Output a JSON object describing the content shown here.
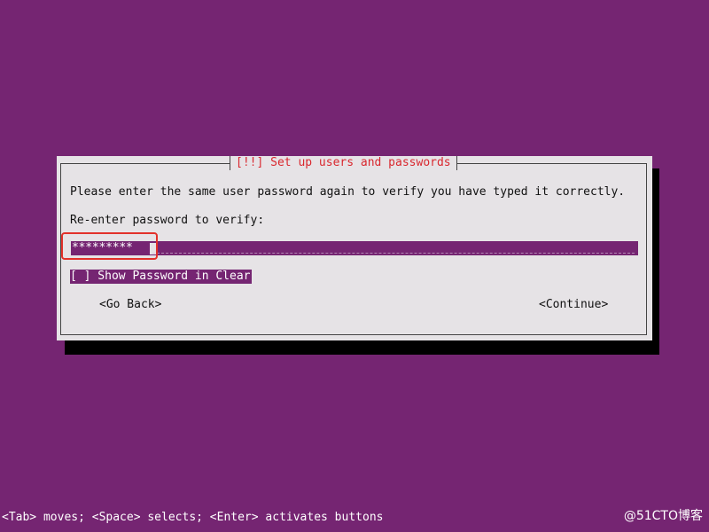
{
  "installer": {
    "dialog_title": "[!!] Set up users and passwords",
    "instruction": "Please enter the same user password again to verify you have typed it correctly.",
    "prompt": "Re-enter password to verify:",
    "password_value": "*********",
    "show_password_label": "[ ] Show Password in Clear",
    "buttons": {
      "go_back": "<Go Back>",
      "continue": "<Continue>"
    }
  },
  "footer": {
    "help_text": "<Tab> moves; <Space> selects; <Enter> activates buttons",
    "watermark": "@51CTO博客"
  },
  "colors": {
    "background": "#752572",
    "dialog": "#e6e3e6",
    "title": "#d9282f",
    "highlight": "#e2312a",
    "selected_text": "#ffffff"
  }
}
